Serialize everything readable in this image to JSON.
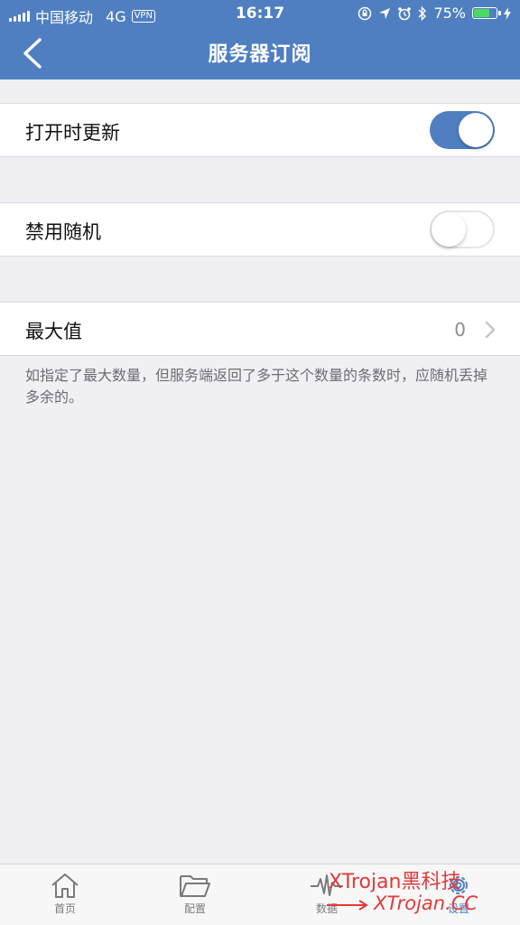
{
  "status_bar": {
    "carrier": "中国移动",
    "network": "4G",
    "vpn": "VPN",
    "time": "16:17",
    "battery_percent": "75%",
    "battery_level": 0.75,
    "icons": [
      "screen-lock-icon",
      "location-icon",
      "alarm-icon",
      "bluetooth-icon",
      "battery-icon"
    ]
  },
  "nav": {
    "title": "服务器订阅",
    "back_icon": "chevron-left-icon"
  },
  "settings": {
    "update_on_open": {
      "label": "打开时更新",
      "enabled": true
    },
    "disable_random": {
      "label": "禁用随机",
      "enabled": false
    },
    "max_value": {
      "label": "最大值",
      "value": "0"
    },
    "footnote": "如指定了最大数量，但服务端返回了多于这个数量的条数时，应随机丢掉多余的。"
  },
  "tab_bar": {
    "tabs": [
      {
        "label": "首页",
        "icon": "home-icon"
      },
      {
        "label": "配置",
        "icon": "folder-icon"
      },
      {
        "label": "数据",
        "icon": "activity-icon"
      },
      {
        "label": "设置",
        "icon": "gear-icon"
      }
    ]
  },
  "watermark": {
    "line1": "XTrojan黑科技",
    "line2": "XTrojan.CC"
  },
  "colors": {
    "accent": "#4f7fc0",
    "background": "#efeff4",
    "watermark": "#e23a3a"
  }
}
